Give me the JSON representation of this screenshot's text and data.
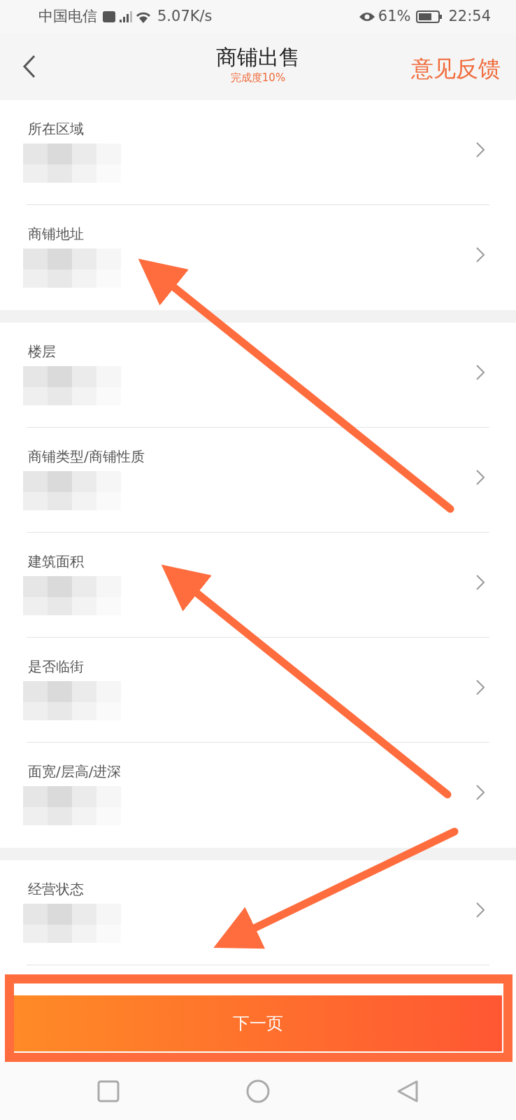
{
  "status_bar": {
    "carrier": "中国电信",
    "network_speed": "5.07K/s",
    "battery": "61%",
    "time": "22:54"
  },
  "header": {
    "title": "商铺出售",
    "progress": "完成度10%",
    "feedback": "意见反馈"
  },
  "sections": [
    {
      "rows": [
        {
          "label": "所在区域"
        },
        {
          "label": "商铺地址"
        }
      ]
    },
    {
      "rows": [
        {
          "label": "楼层"
        },
        {
          "label": "商铺类型/商铺性质"
        },
        {
          "label": "建筑面积"
        },
        {
          "label": "是否临街"
        },
        {
          "label": "面宽/层高/进深"
        }
      ]
    },
    {
      "rows": [
        {
          "label": "经营状态"
        }
      ]
    }
  ],
  "next_button": "下一页"
}
